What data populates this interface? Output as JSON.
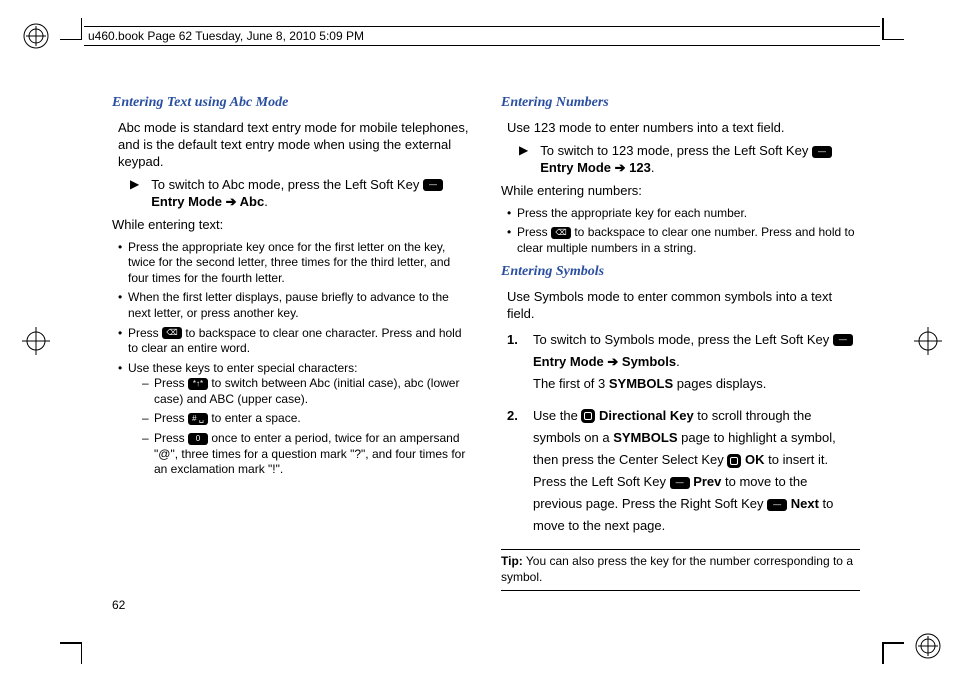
{
  "meta": {
    "header": "u460.book  Page 62  Tuesday, June 8, 2010  5:09 PM"
  },
  "pageNumber": "62",
  "left": {
    "heading": "Entering Text using Abc Mode",
    "intro": "Abc mode is standard text entry mode for mobile telephones, and is the default text entry mode when using the external keypad.",
    "switch_pre": "To switch to Abc mode, press the Left Soft Key ",
    "switch_entry": " Entry Mode ➔ Abc",
    "period": ".",
    "while": "While entering text:",
    "b1": "Press the appropriate key once for the first letter on the key, twice for the second letter, three times for the third letter, and four times for the fourth letter.",
    "b2": "When the first letter displays, pause briefly to advance to the next letter, or press another key.",
    "b3_pre": "Press ",
    "b3_post": " to backspace to clear one character. Press and hold to clear an entire word.",
    "b4": "Use these keys to enter special characters:",
    "s1_pre": "Press ",
    "s1_post": " to switch between Abc (initial case), abc (lower case) and ABC (upper case).",
    "s2_pre": "Press ",
    "s2_post": " to enter a space.",
    "s3_pre": "Press ",
    "s3_post": " once to enter a period, twice for an ampersand \"@\", three times for a question mark \"?\", and four times for an exclamation mark \"!\"."
  },
  "right": {
    "heading_num": "Entering Numbers",
    "intro_num": "Use 123 mode to enter numbers into a text field.",
    "switch_num_pre": "To switch to 123 mode, press the Left Soft Key ",
    "switch_num_entry": " Entry Mode ➔ 123",
    "while_num": "While entering numbers:",
    "nb1": "Press the appropriate key for each number.",
    "nb2_pre": "Press ",
    "nb2_post": " to backspace to clear one number. Press and hold to clear multiple numbers in a string.",
    "heading_sym": "Entering Symbols",
    "intro_sym": "Use Symbols mode to enter common symbols into a text field.",
    "s1_pre": "To switch to Symbols mode, press the Left Soft Key ",
    "s1_entry": " Entry Mode ➔ Symbols",
    "s1_after": "The first of 3 ",
    "s1_sym": "SYMBOLS",
    "s1_pages": " pages displays.",
    "s2_a": "Use the ",
    "s2_dk": " Directional Key",
    "s2_b": " to scroll through the symbols on a ",
    "s2_sym": "SYMBOLS",
    "s2_c": " page to highlight a symbol, then press the Center Select Key ",
    "s2_ok": " OK",
    "s2_d": " to insert it. Press the Left Soft Key ",
    "s2_prev": " Prev",
    "s2_e": " to move to the previous page. Press the Right Soft Key ",
    "s2_next": " Next",
    "s2_f": " to move to the next page.",
    "tip_label": "Tip:",
    "tip_text": " You can also press the key for the number corresponding to a symbol."
  }
}
